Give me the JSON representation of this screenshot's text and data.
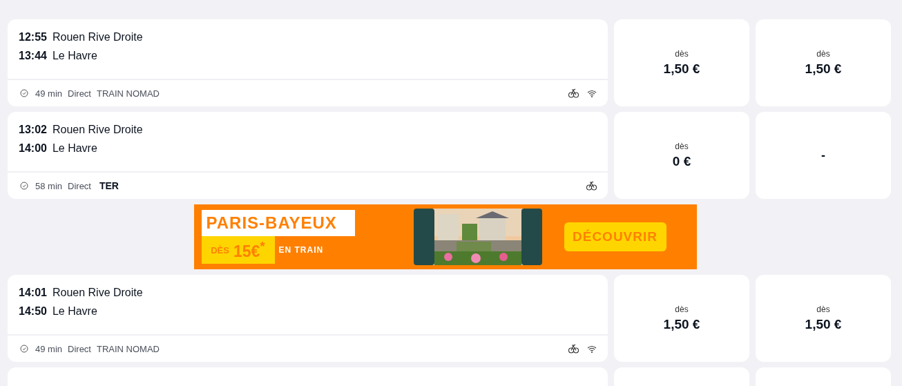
{
  "results": [
    {
      "kind": "journey",
      "departure": {
        "time": "12:55",
        "station": "Rouen Rive Droite"
      },
      "arrival": {
        "time": "13:44",
        "station": "Le Havre"
      },
      "duration": "49 min",
      "type": "Direct",
      "carrier": {
        "kind": "plain",
        "label": "TRAIN NOMAD"
      },
      "amenities": [
        {
          "kind": "bike"
        },
        {
          "kind": "wifi"
        }
      ],
      "prices": [
        {
          "prefix": "dès",
          "amount": "1,50 €"
        },
        {
          "prefix": "dès",
          "amount": "1,50 €"
        }
      ]
    },
    {
      "kind": "journey",
      "departure": {
        "time": "13:02",
        "station": "Rouen Rive Droite"
      },
      "arrival": {
        "time": "14:00",
        "station": "Le Havre"
      },
      "duration": "58 min",
      "type": "Direct",
      "carrier": {
        "kind": "logo",
        "label": "TER"
      },
      "amenities": [
        {
          "kind": "bike"
        }
      ],
      "prices": [
        {
          "prefix": "dès",
          "amount": "0 €"
        },
        {
          "amount": "-"
        }
      ]
    },
    {
      "kind": "banner",
      "title": "PARIS-BAYEUX",
      "from": "DÈS",
      "price": "15€$^{*}$",
      "mode": "EN TRAIN",
      "cta": "DÉCOUVRIR"
    },
    {
      "kind": "journey",
      "departure": {
        "time": "14:01",
        "station": "Rouen Rive Droite"
      },
      "arrival": {
        "time": "14:50",
        "station": "Le Havre"
      },
      "duration": "49 min",
      "type": "Direct",
      "carrier": {
        "kind": "plain",
        "label": "TRAIN NOMAD"
      },
      "amenities": [
        {
          "kind": "bike"
        },
        {
          "kind": "wifi"
        }
      ],
      "prices": [
        {
          "prefix": "dès",
          "amount": "1,50 €"
        },
        {
          "prefix": "dès",
          "amount": "1,50 €"
        }
      ]
    }
  ]
}
